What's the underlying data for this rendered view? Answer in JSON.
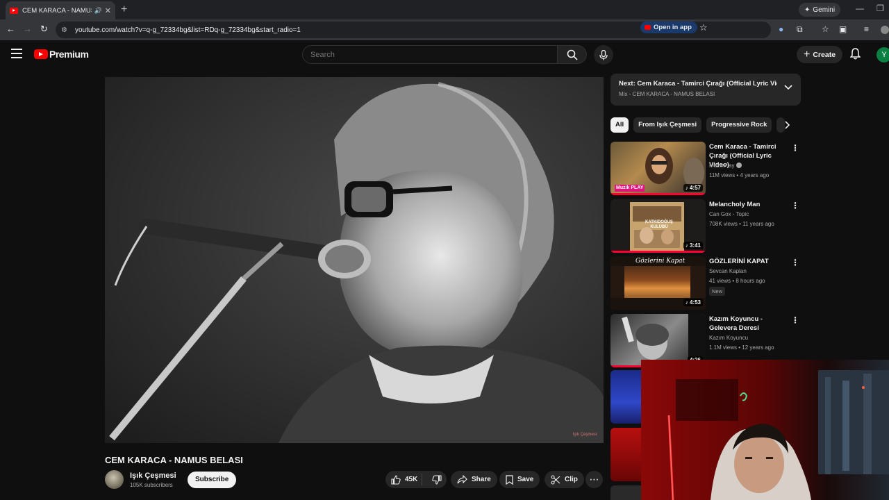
{
  "browser": {
    "tab_title": "CEM KARACA - NAMUS BELASI",
    "gemini_label": "Gemini",
    "url": "youtube.com/watch?v=q-g_72334bg&list=RDq-g_72334bg&start_radio=1",
    "open_in_app_label": "Open in app"
  },
  "header": {
    "logo_text": "Premium",
    "search_placeholder": "Search",
    "create_label": "Create",
    "avatar_letter": "Y"
  },
  "video": {
    "title": "CEM KARACA - NAMUS BELASI",
    "channel_name": "Işık Çeşmesi",
    "subscribers": "105K subscribers",
    "subscribe_label": "Subscribe",
    "likes": "45K",
    "share_label": "Share",
    "save_label": "Save",
    "clip_label": "Clip",
    "watermark": "Işık Çeşmesi"
  },
  "sidebar": {
    "next_title": "Next: Cem Karaca - Tamirci Çırağı (Official Lyric Vid...",
    "next_subtitle": "Mix - CEM KARACA - NAMUS BELASI",
    "chips": [
      "All",
      "From Işık Çeşmesi",
      "Progressive Rock"
    ],
    "recommendations": [
      {
        "title": "Cem Karaca - Tamirci Çırağı (Official Lyric Video)",
        "channel": "MuzikPlay",
        "meta": "11M views • 4 years ago",
        "duration": "4:57",
        "thumb_label": "Muzik PLAY",
        "progress": 1.0
      },
      {
        "title": "Melancholy Man",
        "channel": "Can Gox - Topic",
        "meta": "708K views • 11 years ago",
        "duration": "3:41",
        "thumb_label": "KATKIDOĞUŞ KULÜBÜ",
        "progress": 1.0
      },
      {
        "title": "GÖZLERİNİ KAPAT",
        "channel": "Sevcan Kaplan",
        "meta": "41 views • 8 hours ago",
        "badge": "New",
        "duration": "4:53",
        "thumb_label": "Gözlerini Kapat",
        "progress": 0
      },
      {
        "title": "Kazım Koyuncu - Gelevera Deresi",
        "channel": "Kazım Koyuncu",
        "meta": "1.1M views • 12 years ago",
        "duration": "4:26",
        "progress": 1.0
      }
    ]
  },
  "colors": {
    "background": "#0f0f0f",
    "accent_red": "#ff0033",
    "surface": "#272727"
  }
}
